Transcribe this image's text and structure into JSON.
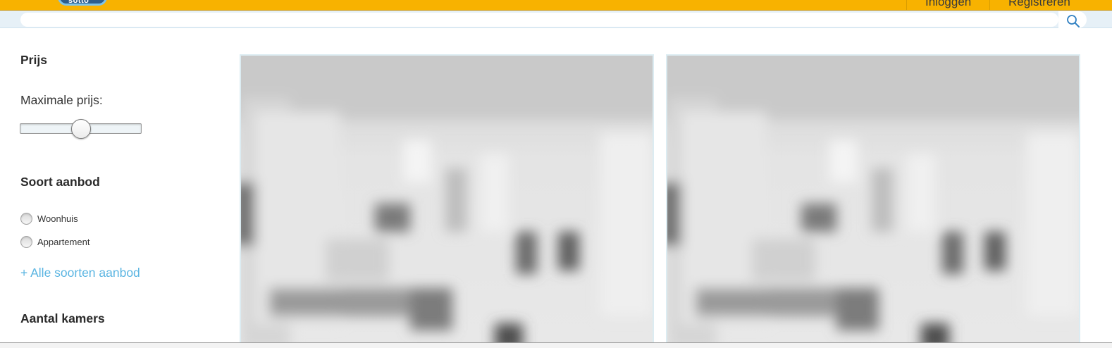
{
  "header": {
    "logo_text": "sotto",
    "login_label": "Inloggen",
    "register_label": "Registreren"
  },
  "search": {
    "placeholder": "",
    "value": "",
    "icon": "search-icon"
  },
  "filters": {
    "price": {
      "heading": "Prijs",
      "max_label": "Maximale prijs:",
      "slider_position": 0.5
    },
    "offer_type": {
      "heading": "Soort aanbod",
      "options": [
        {
          "label": "Woonhuis",
          "checked": false
        },
        {
          "label": "Appartement",
          "checked": false
        }
      ],
      "more_link": "+ Alle soorten aanbod"
    },
    "rooms": {
      "heading": "Aantal kamers"
    }
  },
  "listings": [
    {
      "image_alt": "blurred interior photo"
    },
    {
      "image_alt": "blurred interior photo"
    }
  ],
  "colors": {
    "header_bg": "#f8b200",
    "search_row_bg": "#e6f0f7",
    "link_blue": "#5bb5e2",
    "card_border": "#dcecf2"
  }
}
